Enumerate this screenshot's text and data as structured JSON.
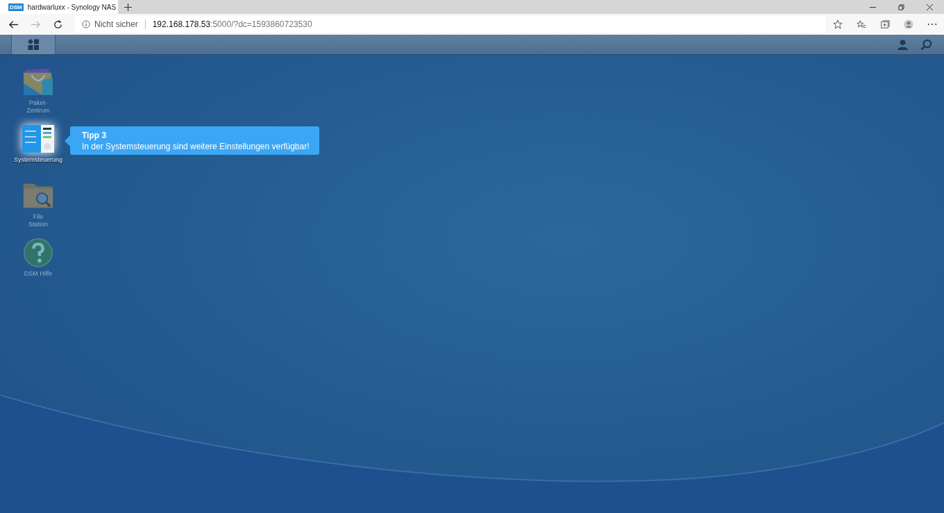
{
  "browser": {
    "tab": {
      "favicon_text": "DSM",
      "title": "hardwarluxx - Synology NAS"
    },
    "address_bar": {
      "security": "Nicht sicher",
      "url_host": "192.168.178.53",
      "url_rest": ":5000/?dc=1593860723530"
    }
  },
  "desktop_icons": [
    {
      "kind": "package",
      "label": "Paket-Zentrum",
      "highlighted": false
    },
    {
      "kind": "control",
      "label": "Systemsteuerung",
      "highlighted": true
    },
    {
      "kind": "folder",
      "label": "File Station",
      "highlighted": false
    },
    {
      "kind": "help",
      "label": "DSM Hilfe",
      "highlighted": false
    }
  ],
  "tooltip": {
    "title": "Tipp 3",
    "text": "In der Systemsteuerung sind weitere Einstellungen verfügbar!"
  }
}
